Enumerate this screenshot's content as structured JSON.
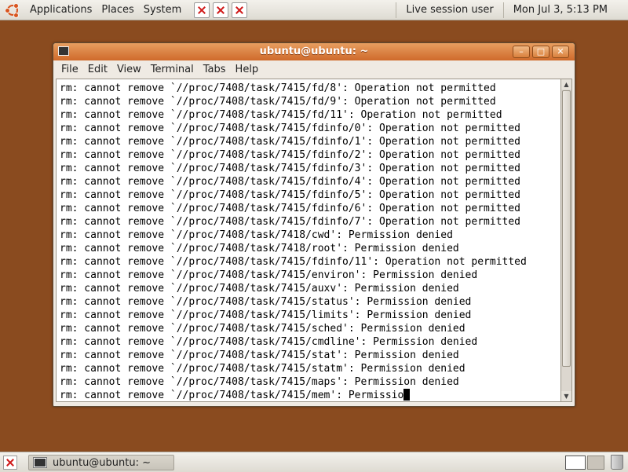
{
  "top_panel": {
    "menus": [
      "Applications",
      "Places",
      "System"
    ],
    "session": "Live session user",
    "clock": "Mon Jul  3,  5:13 PM"
  },
  "window": {
    "title": "ubuntu@ubuntu: ~",
    "menus": [
      "File",
      "Edit",
      "View",
      "Terminal",
      "Tabs",
      "Help"
    ],
    "controls": {
      "minimize": "–",
      "maximize": "□",
      "close": "✕"
    }
  },
  "terminal": {
    "lines": [
      "rm: cannot remove `//proc/7408/task/7415/fd/8': Operation not permitted",
      "rm: cannot remove `//proc/7408/task/7415/fd/9': Operation not permitted",
      "rm: cannot remove `//proc/7408/task/7415/fd/11': Operation not permitted",
      "rm: cannot remove `//proc/7408/task/7415/fdinfo/0': Operation not permitted",
      "rm: cannot remove `//proc/7408/task/7415/fdinfo/1': Operation not permitted",
      "rm: cannot remove `//proc/7408/task/7415/fdinfo/2': Operation not permitted",
      "rm: cannot remove `//proc/7408/task/7415/fdinfo/3': Operation not permitted",
      "rm: cannot remove `//proc/7408/task/7415/fdinfo/4': Operation not permitted",
      "rm: cannot remove `//proc/7408/task/7415/fdinfo/5': Operation not permitted",
      "rm: cannot remove `//proc/7408/task/7415/fdinfo/6': Operation not permitted",
      "rm: cannot remove `//proc/7408/task/7415/fdinfo/7': Operation not permitted",
      "rm: cannot remove `//proc/7408/task/7418/cwd': Permission denied",
      "rm: cannot remove `//proc/7408/task/7418/root': Permission denied",
      "rm: cannot remove `//proc/7408/task/7415/fdinfo/11': Operation not permitted",
      "rm: cannot remove `//proc/7408/task/7415/environ': Permission denied",
      "rm: cannot remove `//proc/7408/task/7415/auxv': Permission denied",
      "rm: cannot remove `//proc/7408/task/7415/status': Permission denied",
      "rm: cannot remove `//proc/7408/task/7415/limits': Permission denied",
      "rm: cannot remove `//proc/7408/task/7415/sched': Permission denied",
      "rm: cannot remove `//proc/7408/task/7415/cmdline': Permission denied",
      "rm: cannot remove `//proc/7408/task/7415/stat': Permission denied",
      "rm: cannot remove `//proc/7408/task/7415/statm': Permission denied",
      "rm: cannot remove `//proc/7408/task/7415/maps': Permission denied",
      "rm: cannot remove `//proc/7408/task/7415/mem': Permissio"
    ]
  },
  "bottom_panel": {
    "task_title": "ubuntu@ubuntu: ~"
  },
  "colors": {
    "desktop": "#8a4b1f",
    "titlebar": "#d9803c"
  }
}
